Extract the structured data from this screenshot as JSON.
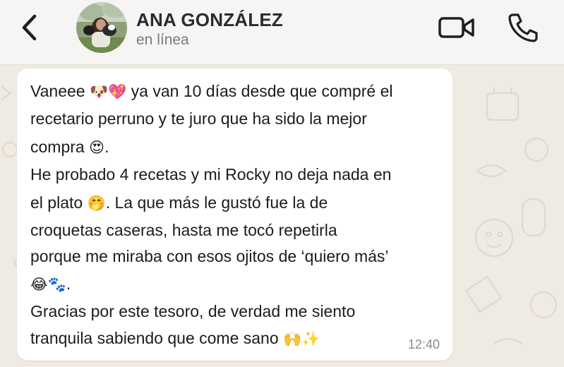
{
  "header": {
    "back_icon": "chevron-left-icon",
    "contact_name": "ANA GONZÁLEZ",
    "status": "en línea",
    "video_icon": "video-camera-icon",
    "call_icon": "phone-icon"
  },
  "message": {
    "lines": [
      {
        "text": "Vaneee",
        "emoji_1": "🐶💖",
        "text_2": "ya van 10 días desde que compré el"
      },
      {
        "text": "recetario perruno y te juro que ha sido la mejor"
      },
      {
        "text": "compra",
        "emoji_1": "😍",
        "text_2": "."
      },
      {
        "text": "He probado 4 recetas y mi Rocky no deja nada en"
      },
      {
        "text": "el plato",
        "emoji_1": "🤭",
        "text_2": ". La que más le gustó fue la de"
      },
      {
        "text": "croquetas caseras, hasta me tocó repetirla"
      },
      {
        "text": "porque me miraba con esos ojitos de ‘quiero más’"
      },
      {
        "text": "",
        "emoji_1": "😂🐾",
        "text_2": "."
      },
      {
        "text": "Gracias por este tesoro, de verdad me siento"
      },
      {
        "text": "tranquila sabiendo que come sano",
        "emoji_1": "🙌✨"
      }
    ],
    "time": "12:40"
  },
  "colors": {
    "header_bg": "#f6f5f3",
    "chat_bg": "#efeae2",
    "bubble_bg": "#ffffff",
    "text": "#1c1c1c",
    "muted": "#7b7b7b"
  }
}
